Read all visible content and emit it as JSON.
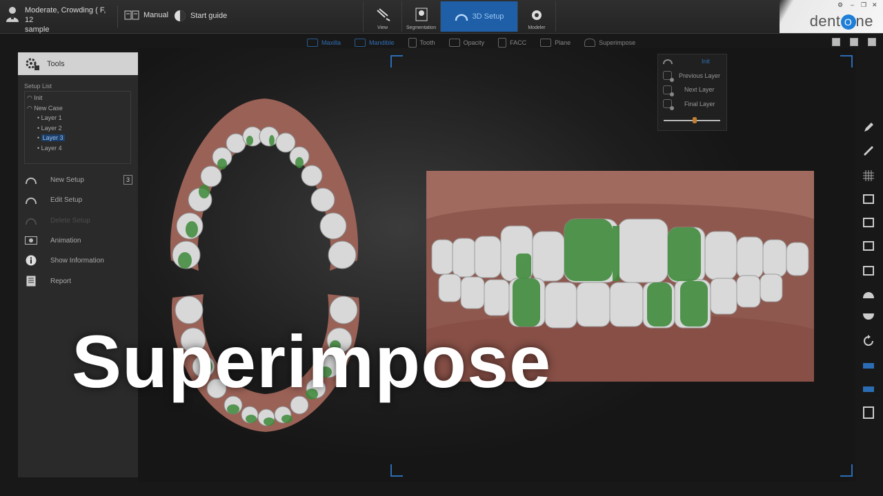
{
  "patient": {
    "name_line1": "Moderate, Crowding ( F, 12",
    "name_line2": "sample"
  },
  "toolbar": {
    "manual_label": "Manual",
    "guide_label": "Start guide"
  },
  "modes": [
    {
      "label": "View"
    },
    {
      "label": "Segmentation"
    },
    {
      "label": "3D Setup"
    },
    {
      "label": "Modeler"
    }
  ],
  "brand": {
    "logo_pre": "dent",
    "logo_o": "O",
    "logo_post": "ne",
    "accent": "#1f7fd8"
  },
  "viewbar": [
    {
      "label": "Maxilla"
    },
    {
      "label": "Mandible"
    },
    {
      "label": "Tooth"
    },
    {
      "label": "Opacity"
    },
    {
      "label": "FACC"
    },
    {
      "label": "Plane"
    },
    {
      "label": "Superimpose"
    }
  ],
  "superimpose_menu": {
    "init_label": "Init",
    "items": [
      "Previous Layer",
      "Next Layer",
      "Final Layer"
    ],
    "slider_value": 0.55
  },
  "tools": {
    "header": "Tools",
    "setup_list_label": "Setup List",
    "setup_list": [
      {
        "label": "Init",
        "indent": false
      },
      {
        "label": "New Case",
        "indent": false
      },
      {
        "label": "Layer 1",
        "indent": true
      },
      {
        "label": "Layer 2",
        "indent": true
      },
      {
        "label": "Layer 3",
        "indent": true,
        "selected": true
      },
      {
        "label": "Layer 4",
        "indent": true
      }
    ],
    "actions": {
      "new_setup": "New Setup",
      "new_setup_count": "3",
      "edit_setup": "Edit Setup",
      "delete_setup": "Delete Setup",
      "animation": "Animation",
      "show_information": "Show Information",
      "report": "Report"
    }
  },
  "overlay_title": "Superimpose",
  "colors": {
    "gum": "#9a6156",
    "tooth": "#d8d8d8",
    "movement": "#3e8a3a",
    "active_blue": "#1e5fa8"
  }
}
